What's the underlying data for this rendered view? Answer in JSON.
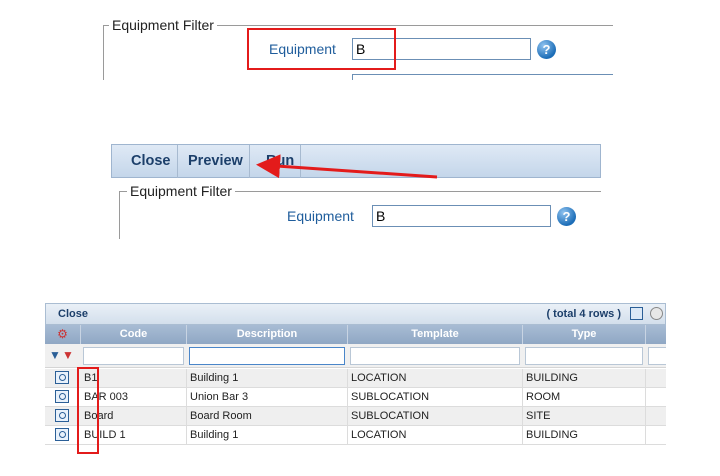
{
  "panel1": {
    "legend": "Equipment Filter",
    "equipment_label": "Equipment",
    "equipment_value": "B",
    "help_icon": "help-icon"
  },
  "panel2": {
    "toolbar": {
      "close_label": "Close",
      "preview_label": "Preview",
      "run_label": "Run"
    },
    "legend": "Equipment Filter",
    "equipment_label": "Equipment",
    "equipment_value": "B",
    "help_icon": "help-icon"
  },
  "grid": {
    "close_label": "Close",
    "total_label": "( total 4 rows )",
    "columns": [
      "Code",
      "Description",
      "Template",
      "Type"
    ],
    "rows": [
      {
        "code": "B1",
        "description": "Building 1",
        "template": "LOCATION",
        "type": "BUILDING"
      },
      {
        "code": "BAR 003",
        "description": "Union Bar 3",
        "template": "SUBLOCATION",
        "type": "ROOM"
      },
      {
        "code": "Board",
        "description": "Board Room",
        "template": "SUBLOCATION",
        "type": "SITE"
      },
      {
        "code": "BUILD 1",
        "description": "Building 1",
        "template": "LOCATION",
        "type": "BUILDING"
      }
    ]
  },
  "colors": {
    "highlight": "#e31b1b",
    "header": "#8fa7c4",
    "label": "#1f5d9c"
  }
}
